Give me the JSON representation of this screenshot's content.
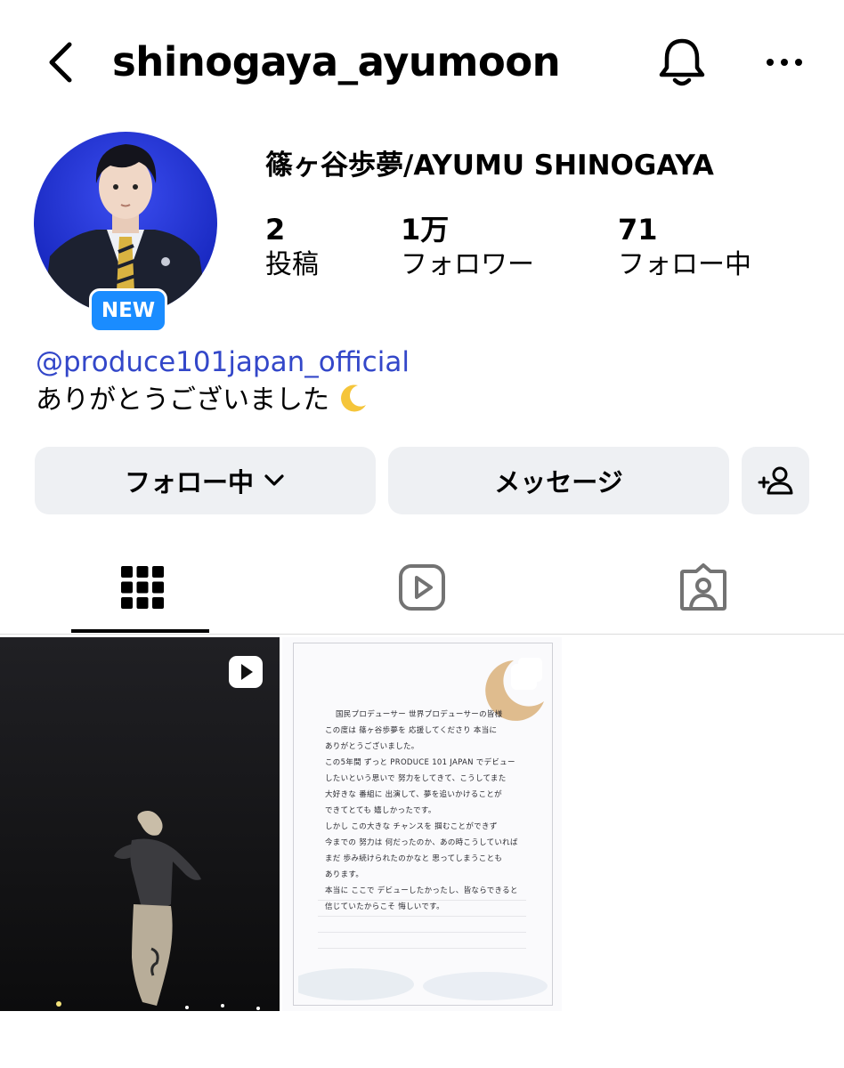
{
  "header": {
    "username": "shinogaya_ayumoon"
  },
  "profile": {
    "badge": "NEW",
    "full_name": "篠ヶ谷歩夢/AYUMU SHINOGAYA",
    "stats": [
      {
        "value": "2",
        "label": "投稿"
      },
      {
        "value": "1万",
        "label": "フォロワー"
      },
      {
        "value": "71",
        "label": "フォロー中"
      }
    ],
    "mention": "@produce101japan_official",
    "bio": "ありがとうございました"
  },
  "actions": {
    "following_label": "フォロー中",
    "message_label": "メッセージ"
  },
  "tabs": [
    {
      "icon": "grid-icon",
      "selected": true
    },
    {
      "icon": "reels-icon",
      "selected": false
    },
    {
      "icon": "tagged-icon",
      "selected": false
    }
  ],
  "posts": [
    {
      "type": "reel",
      "icon": "reel-play-icon"
    },
    {
      "type": "image",
      "icon": "carousel-icon"
    }
  ],
  "letter": {
    "lines": [
      "国民プロデューサー 世界プロデューサーの皆様",
      "この度は 篠ヶ谷歩夢を 応援してくださり 本当に",
      "ありがとうございました。",
      "この5年間 ずっと PRODUCE 101 JAPAN でデビュー",
      "したいという思いで 努力をしてきて、こうしてまた",
      "大好きな 番組に 出演して、夢を追いかけることが",
      "できてとても 嬉しかったです。",
      "しかし この大きな チャンスを 掴むことができず",
      "今までの 努力は 何だったのか、あの時こうしていれば",
      "まだ 歩み続けられたのかなと 思ってしまうことも",
      "あります。",
      "本当に ここで デビューしたかったし、皆ならできると",
      "信じていたからこそ 悔しいです。"
    ]
  }
}
